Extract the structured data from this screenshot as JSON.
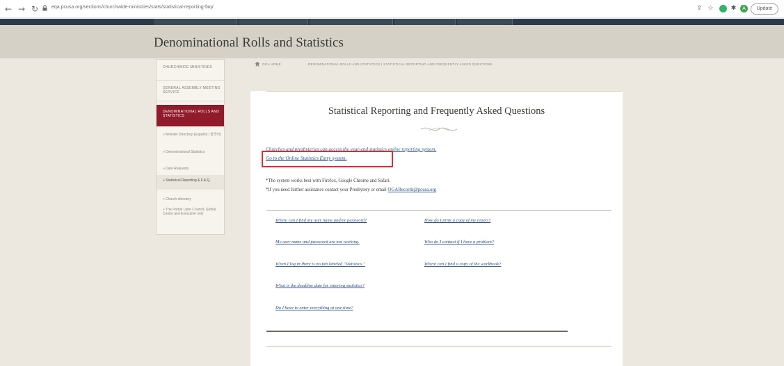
{
  "browser": {
    "url": "eqa.pcusa.org/sections/churchwide-ministries/stats/statistical-reporting-faq/",
    "update_label": "Update",
    "avatar_letter": "A"
  },
  "header": {
    "title": "Denominational Rolls and Statistics"
  },
  "sidebar": {
    "items": [
      {
        "label": "CHURCHWIDE MINISTRIES"
      },
      {
        "label": "GENERAL ASSEMBLY MEETING SERVICE"
      },
      {
        "label": "DENOMINATIONAL ROLLS AND STATISTICS"
      }
    ],
    "subitems": [
      {
        "label": "» Minister Directory (Español | 한국어)"
      },
      {
        "label": "» Denominational Statistics"
      },
      {
        "label": "» Data Requests"
      },
      {
        "label": "» Statistical Reporting & F.A.Q."
      },
      {
        "label": "» Church directory"
      },
      {
        "label": "» The Partial Later Council, Global Centre and Executive only"
      }
    ]
  },
  "breadcrumb": {
    "home": "OGA HOME",
    "trail": "DENOMINATIONAL ROLLS AND STATISTICS  |  STATISTICAL REPORTING AND FREQUENTLY ASKED QUESTIONS"
  },
  "main": {
    "heading": "Statistical Reporting and Frequently Asked Questions",
    "intro": "Churches and presbyteries can access the year-end statistics online reporting system.",
    "entry_link": "Go to the Online Statistics Entry system.",
    "note1": "*The system works best with Firefox, Google Chrome and Safari.",
    "note2_prefix": "*If you need further assistance contact your Presbytery or email ",
    "note2_email": "OGARecords@pcusa.org",
    "faq_left": [
      "Where can I find my user name and/or password?",
      "My user name and password are not working.",
      "When I log in there is no tab labeled \"Statistics.\"",
      "What is the deadline date for entering statistics?",
      "Do I have to enter everything at one time?"
    ],
    "faq_right": [
      "How do I print a copy of my report?",
      "Who do I contact if I have a problem?",
      "Where can I find a copy of the workbook?"
    ]
  }
}
